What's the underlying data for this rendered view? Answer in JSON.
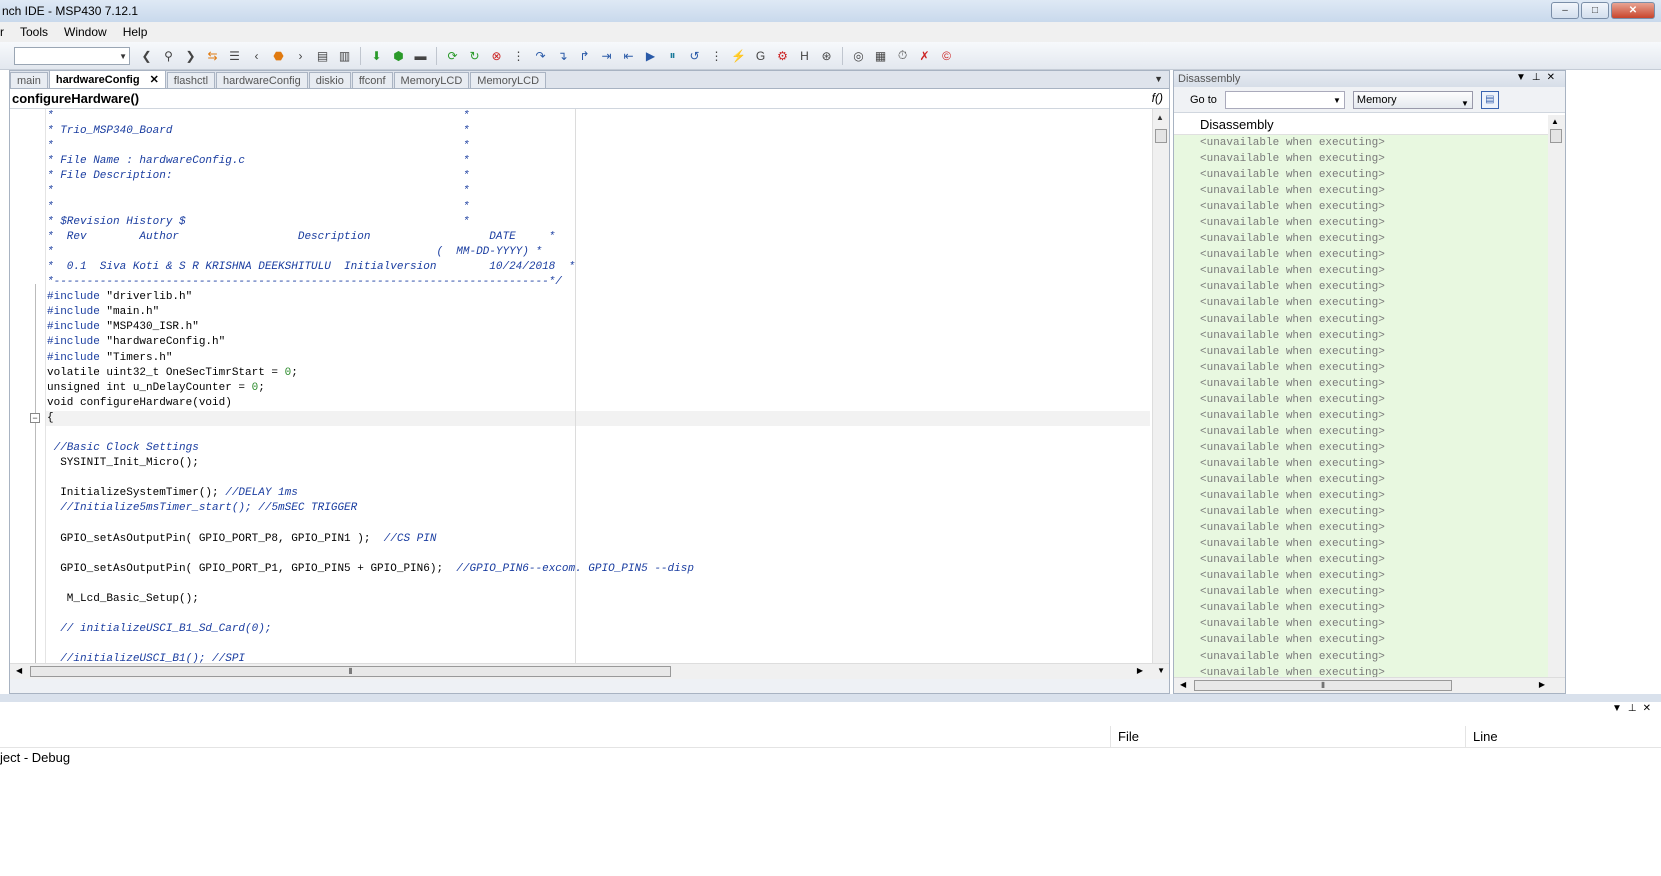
{
  "window": {
    "title": "nch IDE - MSP430 7.12.1",
    "buttons": [
      "–",
      "□",
      "✕"
    ]
  },
  "menubar": {
    "items": [
      "r",
      "Tools",
      "Window",
      "Help"
    ]
  },
  "toolbar": {
    "combo_value": ""
  },
  "editor": {
    "tabs": [
      "main",
      "hardwareConfig",
      "flashctl",
      "hardwareConfig",
      "diskio",
      "ffconf",
      "MemoryLCD",
      "MemoryLCD"
    ],
    "active_tab_close": "✕",
    "function_name": "configureHardware()",
    "fx_icon": "f()",
    "code_lines": [
      "*                                                              *",
      "* Trio_MSP340_Board                                            *",
      "*                                                              *",
      "* File Name : hardwareConfig.c                                 *",
      "* File Description:                                            *",
      "*                                                              *",
      "*                                                              *",
      "* $Revision History $                                          *",
      "*  Rev        Author                  Description                  DATE     *",
      "*                                                          (  MM-DD-YYYY) *",
      "*  0.1  Siva Koti & S R KRISHNA DEEKSHITULU  Initialversion        10/24/2018  *",
      "*---------------------------------------------------------------------------*/",
      "#include \"driverlib.h\"",
      "#include \"main.h\"",
      "#include \"MSP430_ISR.h\"",
      "#include \"hardwareConfig.h\"",
      "#include \"Timers.h\"",
      "volatile uint32_t OneSecTimrStart = 0;",
      "unsigned int u_nDelayCounter = 0;",
      "void configureHardware(void)",
      "{",
      "",
      " //Basic Clock Settings",
      "  SYSINIT_Init_Micro();",
      "",
      "  InitializeSystemTimer(); //DELAY 1ms",
      "  //Initialize5msTimer_start(); //5mSEC TRIGGER",
      "",
      "  GPIO_setAsOutputPin( GPIO_PORT_P8, GPIO_PIN1 );  //CS PIN",
      "",
      "  GPIO_setAsOutputPin( GPIO_PORT_P1, GPIO_PIN5 + GPIO_PIN6);  //GPIO_PIN6--excom. GPIO_PIN5 --disp",
      "",
      "   M_Lcd_Basic_Setup();",
      "",
      "  // initializeUSCI_B1_Sd_Card(0);",
      "",
      "  //initializeUSCI_B1(); //SPI"
    ]
  },
  "disassembly": {
    "panel_title": "Disassembly",
    "goto_label": "Go to",
    "goto_value": "",
    "memory_select": "Memory",
    "header": "Disassembly",
    "line_text": "<unavailable when executing>",
    "line_count": 34
  },
  "bottom_panel": {
    "col_file": "File",
    "col_line": "Line",
    "row_text": "ject - Debug"
  },
  "colors": {
    "disasm_bg": "#e8f8e0",
    "comment": "#1a3da0",
    "number": "#2a8a2a"
  }
}
